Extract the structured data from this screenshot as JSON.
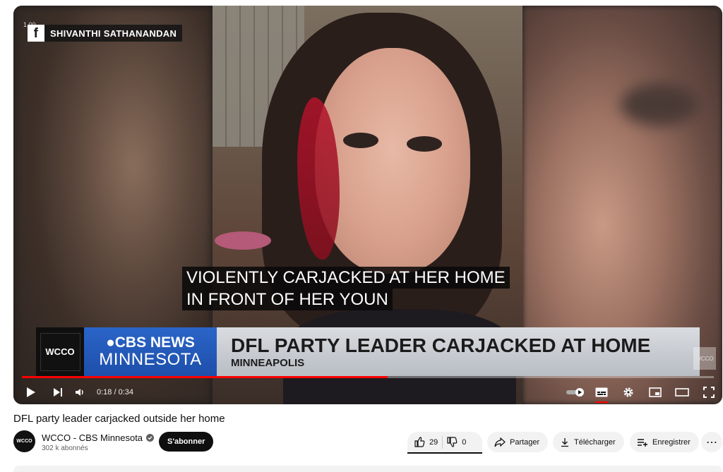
{
  "video": {
    "source_badge": "SHIVANTHI SATHANANDAN",
    "speed_label": "1.00",
    "caption_lines": [
      "VIOLENTLY CARJACKED AT HER HOME",
      "IN FRONT OF HER YOUN"
    ],
    "lower_third": {
      "station": "WCCO",
      "network_top": "●CBS NEWS",
      "network_bottom": "MINNESOTA",
      "headline": "DFL PARTY LEADER CARJACKED AT HOME",
      "location": "MINNEAPOLIS"
    },
    "watermark": "WCCO",
    "time_display": "0:18 / 0:34",
    "progress_fraction": 0.529
  },
  "info": {
    "title": "DFL party leader carjacked outside her home",
    "channel_name": "WCCO - CBS Minnesota",
    "channel_avatar": "WCCO",
    "subscribers": "302 k abonnés",
    "subscribe_label": "S'abonner",
    "likes": "29",
    "dislikes": "0",
    "share_label": "Partager",
    "download_label": "Télécharger",
    "save_label": "Enregistrer",
    "more_label": "⋯"
  },
  "colors": {
    "progress": "#ff0000",
    "cbs_blue": "#2a65c7",
    "button_dark": "#0f0f0f",
    "pill_bg": "#f2f2f2"
  }
}
